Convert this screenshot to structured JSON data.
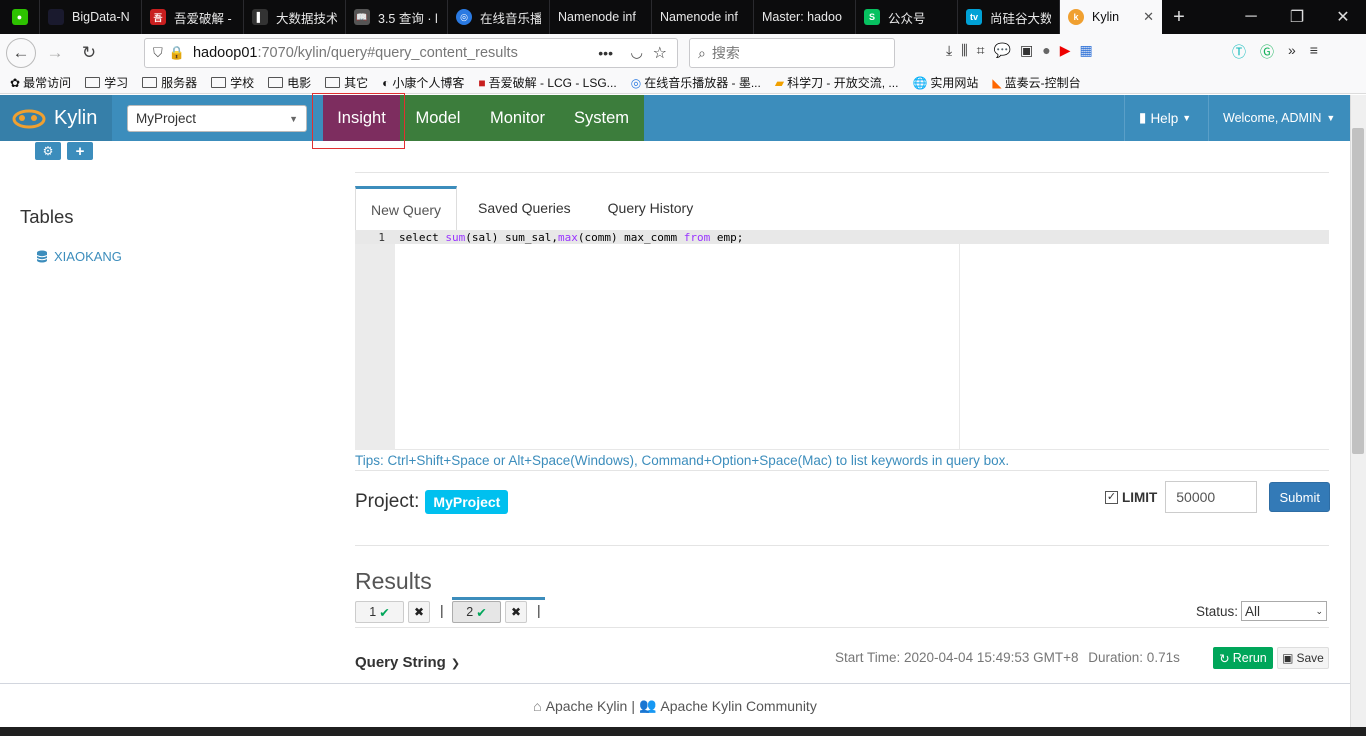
{
  "browser": {
    "tabs": [
      {
        "title": "",
        "icon_color": "#2dc100",
        "icon": "wechat-icon"
      },
      {
        "title": "BigData-N",
        "icon_color": "#1a1a2e",
        "icon": "page-icon"
      },
      {
        "title": "吾爱破解 -",
        "icon_color": "#c81f1f",
        "icon": "52pojie-icon"
      },
      {
        "title": "大数据技术",
        "icon_color": "#333333",
        "icon": "page-icon"
      },
      {
        "title": "3.5 查询 · l",
        "icon_color": "#555555",
        "icon": "book-icon"
      },
      {
        "title": "在线音乐播",
        "icon_color": "#2a7ae2",
        "icon": "globe-icon"
      },
      {
        "title": "Namenode inf",
        "icon_color": "",
        "icon": ""
      },
      {
        "title": "Namenode inf",
        "icon_color": "",
        "icon": ""
      },
      {
        "title": "Master: hadoo",
        "icon_color": "",
        "icon": ""
      },
      {
        "title": "公众号",
        "icon_color": "#07c160",
        "icon": "wechat-mp-icon"
      },
      {
        "title": "尚硅谷大数",
        "icon_color": "#00a1d6",
        "icon": "bilibili-icon"
      },
      {
        "title": "Kylin",
        "icon_color": "#f0a030",
        "icon": "kylin-icon",
        "active": true
      }
    ],
    "url_host": "hadoop01",
    "url_rest": ":7070/kylin/query#query_content_results",
    "search_placeholder": "搜索",
    "bookmarks": [
      "最常访问",
      "学习",
      "服务器",
      "学校",
      "电影",
      "其它",
      "小康个人博客",
      "吾爱破解 - LCG - LSG...",
      "在线音乐播放器 - 墨...",
      "科学刀 - 开放交流, ...",
      "实用网站",
      "蓝奏云-控制台"
    ]
  },
  "kylin": {
    "brand": "Kylin",
    "project_select": "MyProject",
    "nav": [
      "Insight",
      "Model",
      "Monitor",
      "System"
    ],
    "help": "Help",
    "welcome": "Welcome, ADMIN",
    "tables_title": "Tables",
    "table_node": "XIAOKANG",
    "query_tabs": [
      "New Query",
      "Saved Queries",
      "Query History"
    ],
    "line_number": "1",
    "sql": {
      "p1": "select ",
      "k1": "sum",
      "p2": "(sal) sum_sal,",
      "k2": "max",
      "p3": "(comm) max_comm ",
      "k3": "from",
      "p4": " emp;"
    },
    "tips": "Tips: Ctrl+Shift+Space or Alt+Space(Windows), Command+Option+Space(Mac) to list keywords in query box.",
    "project_label": "Project:",
    "project_badge": "MyProject",
    "limit_label": "LIMIT",
    "limit_value": "50000",
    "submit": "Submit",
    "results_title": "Results",
    "result_tabs": [
      "1",
      "2"
    ],
    "status_label": "Status:",
    "status_value": "All",
    "query_string": "Query String",
    "start_time": "Start Time: 2020-04-04 15:49:53 GMT+8",
    "duration": "Duration: 0.71s",
    "rerun": "Rerun",
    "save": "Save",
    "footer_left": "Apache Kylin",
    "footer_sep": "|",
    "footer_right": "Apache Kylin Community"
  }
}
